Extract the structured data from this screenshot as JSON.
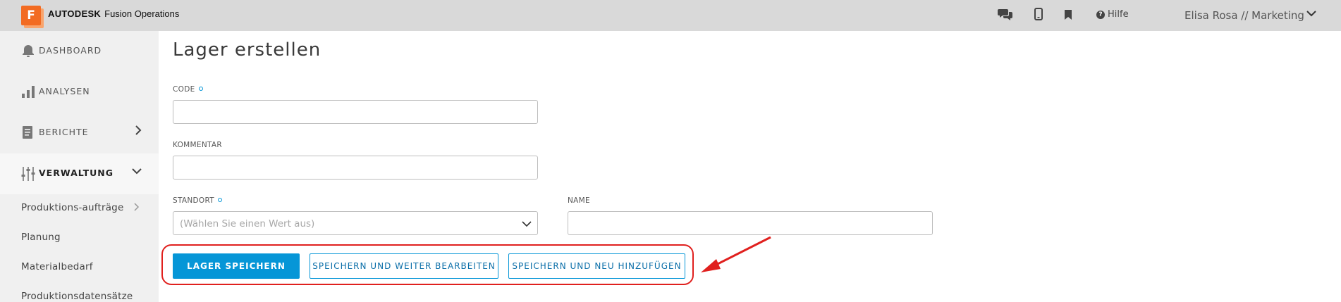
{
  "topbar": {
    "logo_letter": "F",
    "brand_bold": "AUTODESK",
    "brand_rest": "Fusion Operations",
    "icons": [
      "chat-icon",
      "mobile-icon",
      "bookmark-icon"
    ],
    "help_label": "Hilfe",
    "user_label": "Elisa Rosa // Marketing"
  },
  "sidebar": {
    "items": [
      {
        "label": "DASHBOARD",
        "icon": "bell-icon"
      },
      {
        "label": "ANALYSEN",
        "icon": "bar-chart-icon"
      },
      {
        "label": "BERICHTE",
        "icon": "report-icon"
      },
      {
        "label": "VERWALTUNG",
        "icon": "sliders-icon"
      }
    ],
    "sub_items": [
      {
        "label": "Produktions-aufträge"
      },
      {
        "label": "Planung"
      },
      {
        "label": "Materialbedarf"
      },
      {
        "label": "Produktionsdatensätze"
      }
    ]
  },
  "main": {
    "title": "Lager erstellen",
    "fields": {
      "code": {
        "label": "CODE",
        "value": ""
      },
      "kommentar": {
        "label": "KOMMENTAR",
        "value": ""
      },
      "standort": {
        "label": "STANDORT",
        "placeholder": "(Wählen Sie einen Wert aus)"
      },
      "name": {
        "label": "NAME",
        "value": ""
      }
    },
    "buttons": {
      "save": "LAGER SPEICHERN",
      "save_continue": "SPEICHERN UND WEITER BEARBEITEN",
      "save_new": "SPEICHERN UND NEU HINZUFÜGEN"
    }
  },
  "colors": {
    "accent": "#0696d7",
    "brand": "#f26b22",
    "annotation": "#e0201e"
  }
}
